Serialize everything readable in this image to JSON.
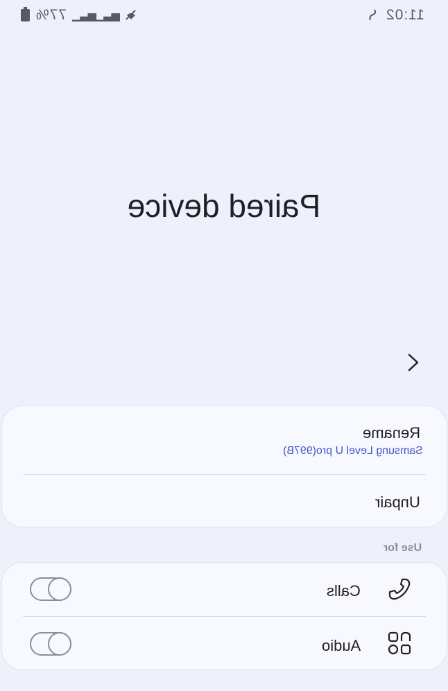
{
  "status_bar": {
    "time": "11:02",
    "battery": "77%"
  },
  "title": "Paired device",
  "device": {
    "rename_label": "Rename",
    "device_name": "Samsung Level U pro(997B)",
    "unpair_label": "Unpair"
  },
  "use_for": {
    "section_label": "Use for",
    "items": [
      {
        "label": "Calls",
        "icon": "phone-icon",
        "enabled": false
      },
      {
        "label": "Audio",
        "icon": "apps-icon",
        "enabled": false
      }
    ]
  }
}
